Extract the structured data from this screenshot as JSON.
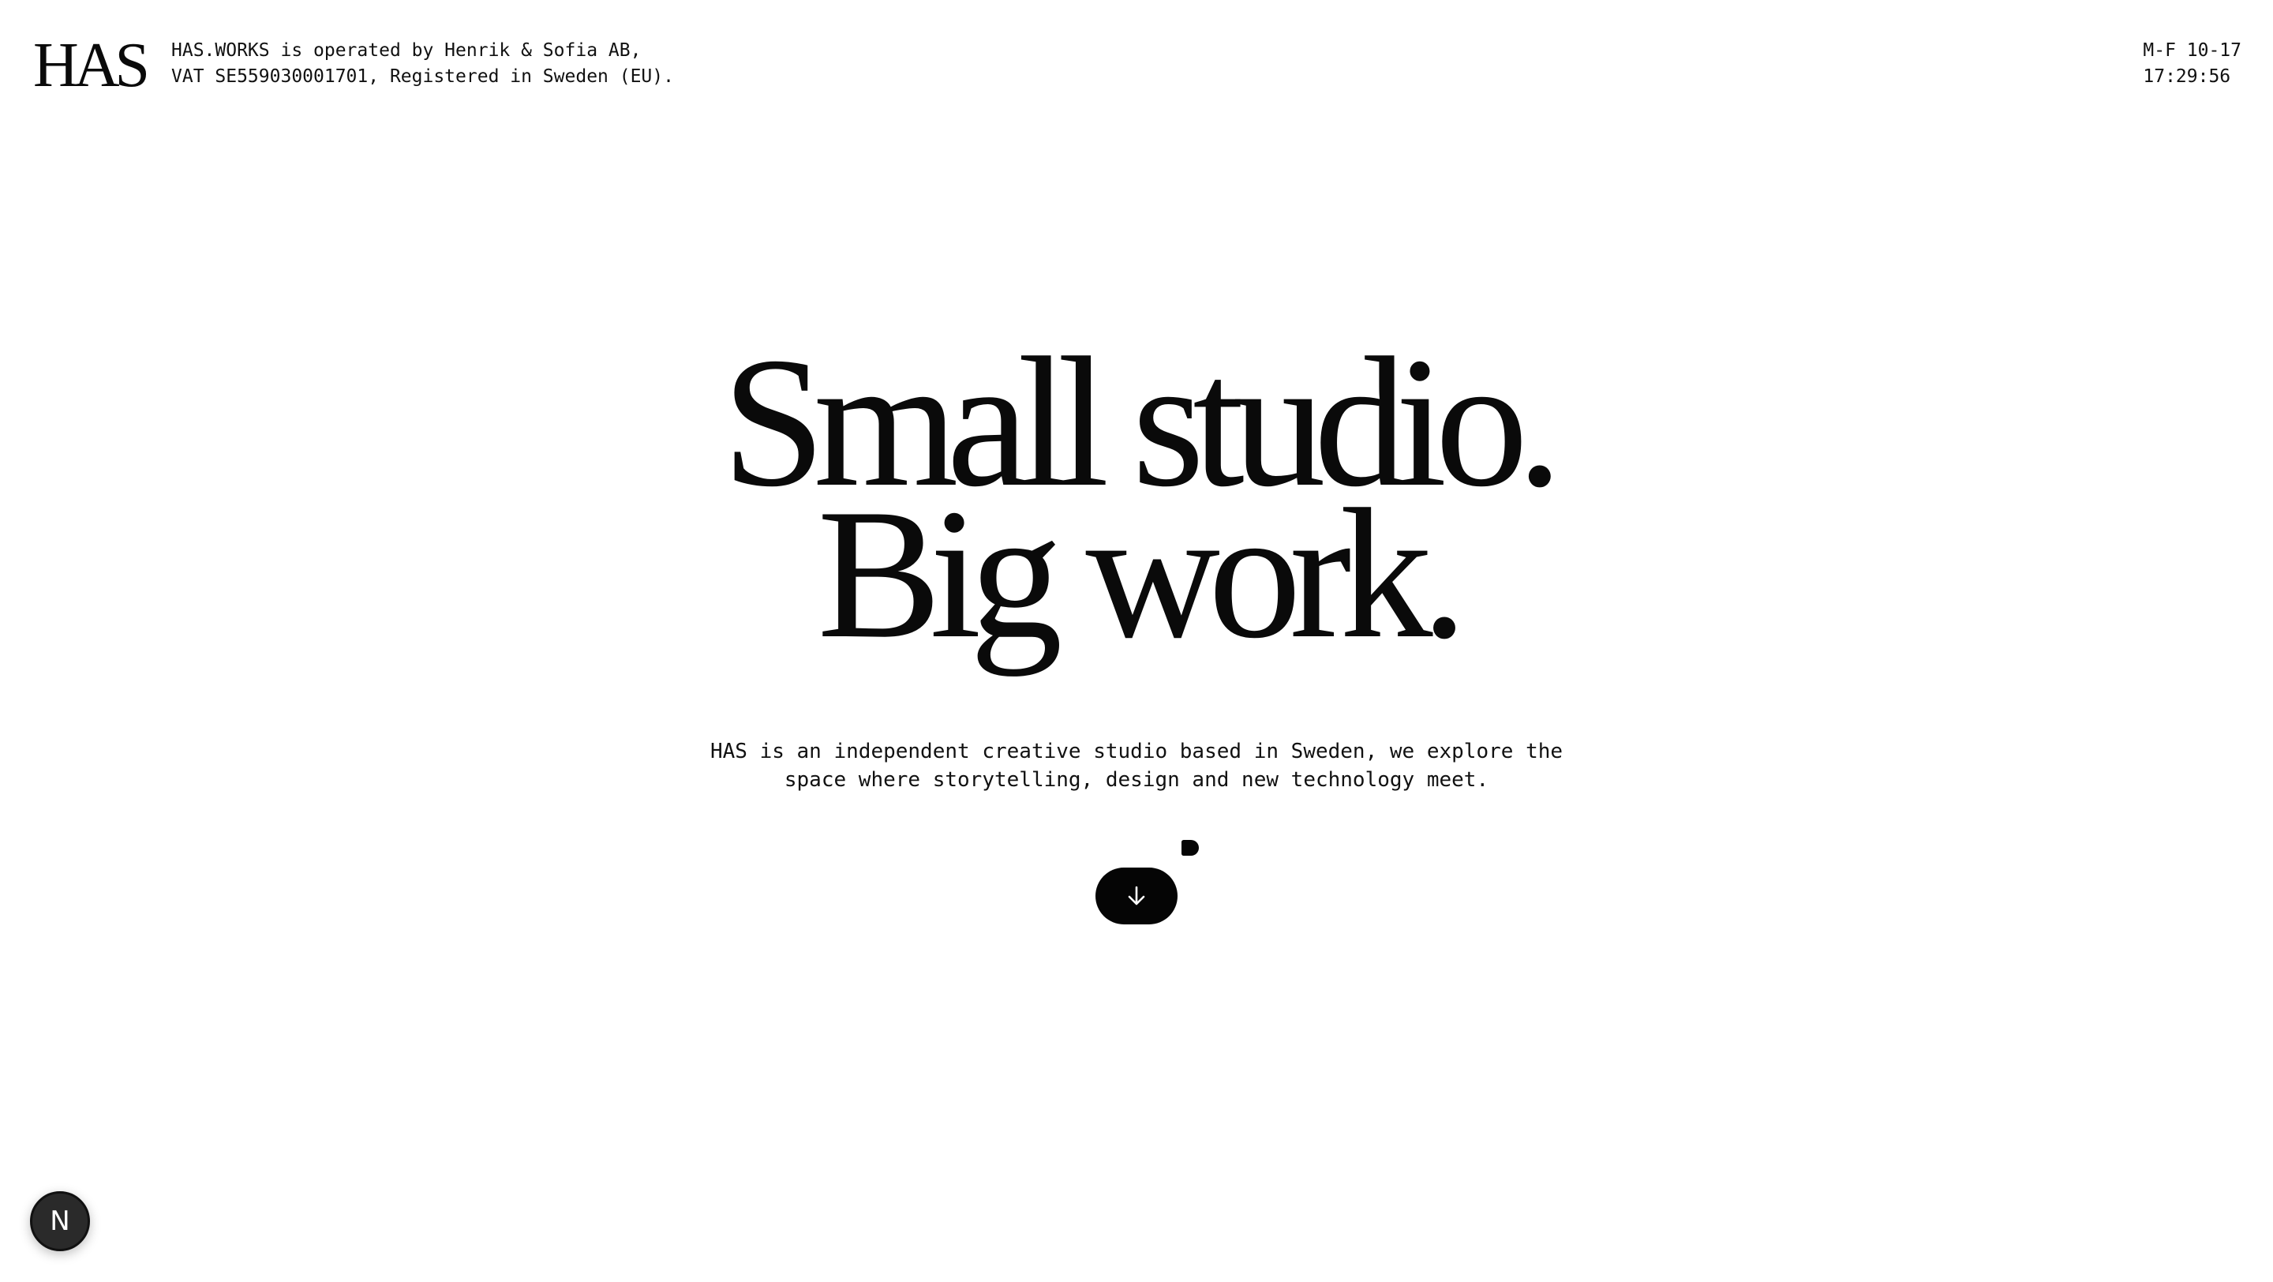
{
  "header": {
    "logo": "HAS",
    "legal_line1": "HAS.WORKS is operated by Henrik & Sofia AB,",
    "legal_line2": "VAT SE559030001701, Registered in Sweden (EU).",
    "hours": "M-F 10-17",
    "clock": "17:29:56"
  },
  "hero": {
    "headline_line1": "Small studio.",
    "headline_line2": "Big work.",
    "intro_line1": "HAS is an independent creative studio based in Sweden, we explore the",
    "intro_line2": "space where storytelling, design and new technology meet.",
    "scroll_icon": "arrow-down-icon"
  },
  "dev_badge": {
    "letter": "N",
    "icon": "nextjs-icon"
  }
}
